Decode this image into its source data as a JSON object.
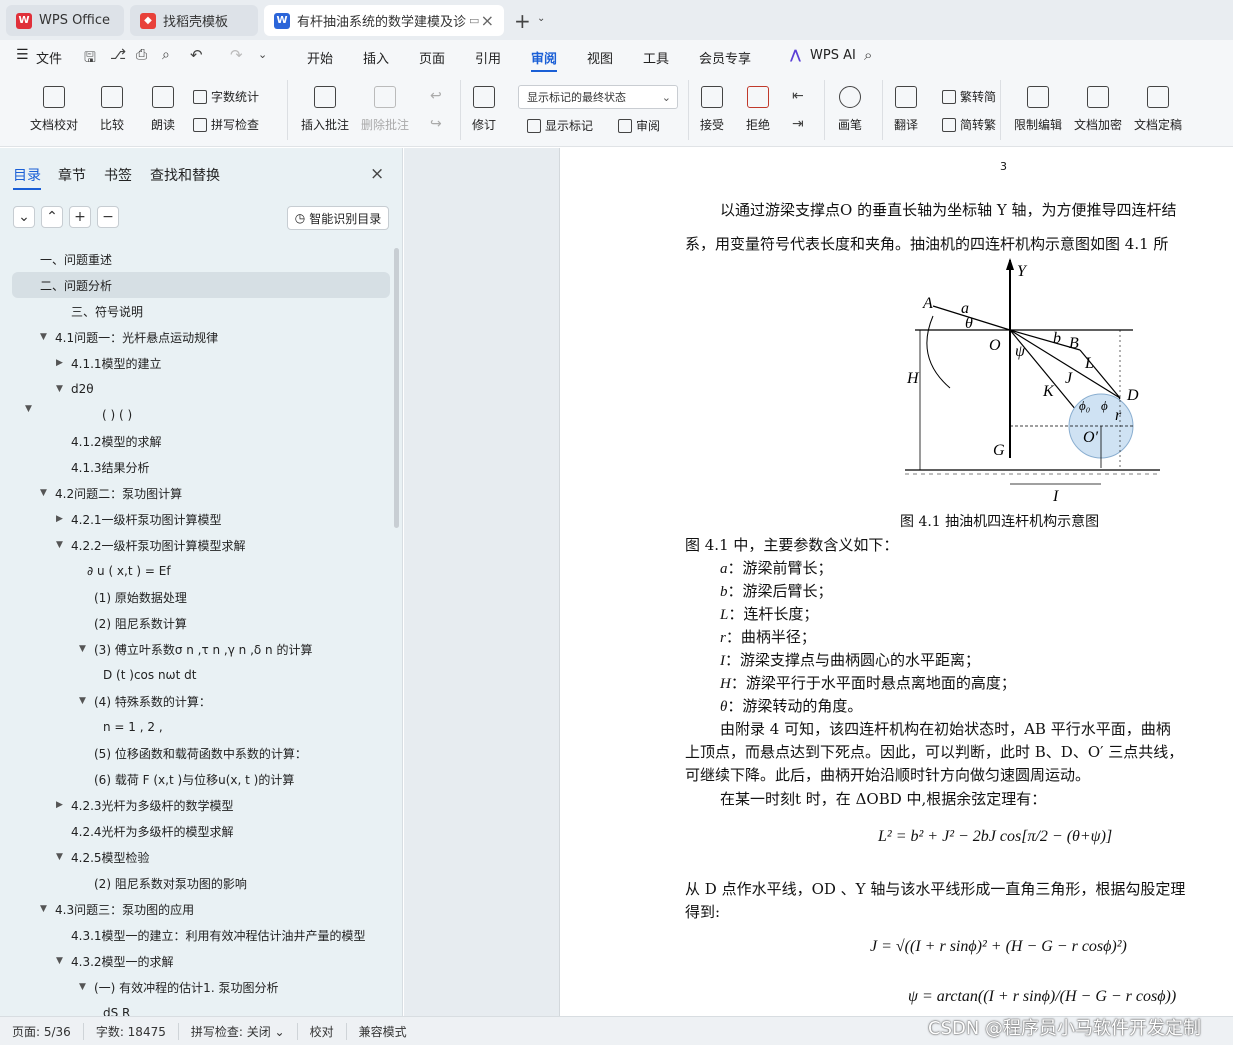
{
  "tabs": [
    {
      "label": "WPS Office"
    },
    {
      "label": "找稻壳模板"
    },
    {
      "label": "有杆抽油系统的数学建模及诊断"
    }
  ],
  "menu": {
    "file": "文件",
    "items": [
      "开始",
      "插入",
      "页面",
      "引用",
      "审阅",
      "视图",
      "工具",
      "会员专享"
    ],
    "active": "审阅",
    "ai": "WPS AI"
  },
  "ribbon": {
    "doc_check": "文档校对",
    "compare": "比较",
    "read_aloud": "朗读",
    "word_count": "字数统计",
    "spell_check": "拼写检查",
    "insert_comment": "插入批注",
    "delete_comment": "删除批注",
    "track": "修订",
    "markup_select": "显示标记的最终状态",
    "show_markup": "显示标记",
    "review": "审阅",
    "accept": "接受",
    "reject": "拒绝",
    "pen": "画笔",
    "translate": "翻译",
    "to_simplified": "繁转简",
    "to_traditional": "简转繁",
    "restrict": "限制编辑",
    "encrypt": "文档加密",
    "finalize": "文档定稿"
  },
  "panel": {
    "tabs": [
      "目录",
      "章节",
      "书签",
      "查找和替换"
    ],
    "smart_toc": "智能识别目录",
    "toc": [
      {
        "label": "一、问题重述"
      },
      {
        "label": "二、问题分析"
      },
      {
        "label": "三、符号说明"
      },
      {
        "label": "4.1问题一：光杆悬点运动规律"
      },
      {
        "label": "4.1.1模型的建立"
      },
      {
        "label": "d2θ"
      },
      {
        "label": "( ) ( )"
      },
      {
        "label": "4.1.2模型的求解"
      },
      {
        "label": "4.1.3结果分析"
      },
      {
        "label": "4.2问题二：泵功图计算"
      },
      {
        "label": "4.2.1一级杆泵功图计算模型"
      },
      {
        "label": "4.2.2一级杆泵功图计算模型求解"
      },
      {
        "label": "∂ u ( x,t ) = Ef"
      },
      {
        "label": "(1) 原始数据处理"
      },
      {
        "label": "(2) 阻尼系数计算"
      },
      {
        "label": "(3) 傅立叶系数σ n ,τ n ,γ n ,δ n 的计算"
      },
      {
        "label": "D (t )cos nωt dt"
      },
      {
        "label": "(4) 特殊系数的计算："
      },
      {
        "label": "n = 1 , 2 ,"
      },
      {
        "label": "(5) 位移函数和载荷函数中系数的计算："
      },
      {
        "label": "(6) 载荷 F (x,t )与位移u(x, t )的计算"
      },
      {
        "label": "4.2.3光杆为多级杆的数学模型"
      },
      {
        "label": "4.2.4光杆为多级杆的模型求解"
      },
      {
        "label": "4.2.5模型检验"
      },
      {
        "label": "(2) 阻尼系数对泵功图的影响"
      },
      {
        "label": "4.3问题三：泵功图的应用"
      },
      {
        "label": "4.3.1模型一的建立：利用有效冲程估计油井产量的模型"
      },
      {
        "label": "4.3.2模型一的求解"
      },
      {
        "label": "(一) 有效冲程的估计1. 泵功图分析"
      },
      {
        "label": "dS R"
      }
    ]
  },
  "document": {
    "page_number": "3",
    "para1_line1": "以通过游梁支撑点O 的垂直长轴为坐标轴 Y 轴，为方便推导四连杆结",
    "para1_line2": "系，用变量符号代表长度和夹角。抽油机的四连杆机构示意图如图 4.1 所",
    "figure_caption": "图 4.1 抽油机四连杆机构示意图",
    "params_intro": "图 4.1 中，主要参数含义如下：",
    "params": [
      {
        "sym": "a",
        "desc": "：游梁前臂长；"
      },
      {
        "sym": "b",
        "desc": "：游梁后臂长；"
      },
      {
        "sym": "L",
        "desc": "：连杆长度；"
      },
      {
        "sym": "r",
        "desc": "：曲柄半径；"
      },
      {
        "sym": "I",
        "desc": "：游梁支撑点与曲柄圆心的水平距离；"
      },
      {
        "sym": "H",
        "desc": "：游梁平行于水平面时悬点离地面的高度；"
      },
      {
        "sym": "θ",
        "desc": "：游梁转动的角度。"
      }
    ],
    "para2_line1": "由附录 4 可知，该四连杆机构在初始状态时，AB 平行水平面，曲柄",
    "para2_line2": "上顶点，而悬点达到下死点。因此，可以判断，此时 B、D、O′ 三点共线，",
    "para2_line3": "可继续下降。此后，曲柄开始沿顺时针方向做匀速圆周运动。",
    "para3": "在某一时刻t 时，在 ΔOBD 中,根据余弦定理有：",
    "eq1": "L² = b² + J² − 2bJ cos[π/2 − (θ+ψ)]",
    "para4_line1": "从 D 点作水平线，OD 、Y 轴与该水平线形成一直角三角形，根据勾股定理",
    "para4_line2": "得到:",
    "eq2": "J = √((I + r sinϕ)² + (H − G − r cosϕ)²)",
    "eq3": "ψ = arctan((I + r sinϕ)/(H − G − r cosϕ))",
    "fig_labels": [
      "A",
      "a",
      "θ",
      "O",
      "ψ",
      "b",
      "B",
      "L",
      "J",
      "K",
      "D",
      "H",
      "G",
      "I",
      "O′",
      "r",
      "Y",
      "ϕ₀",
      "ϕ"
    ]
  },
  "status": {
    "page": "页面: 5/36",
    "words": "字数: 18475",
    "spell": "拼写检查: 关闭",
    "proof": "校对",
    "compat": "兼容模式"
  },
  "watermark": "CSDN @程序员小马软件开发定制"
}
